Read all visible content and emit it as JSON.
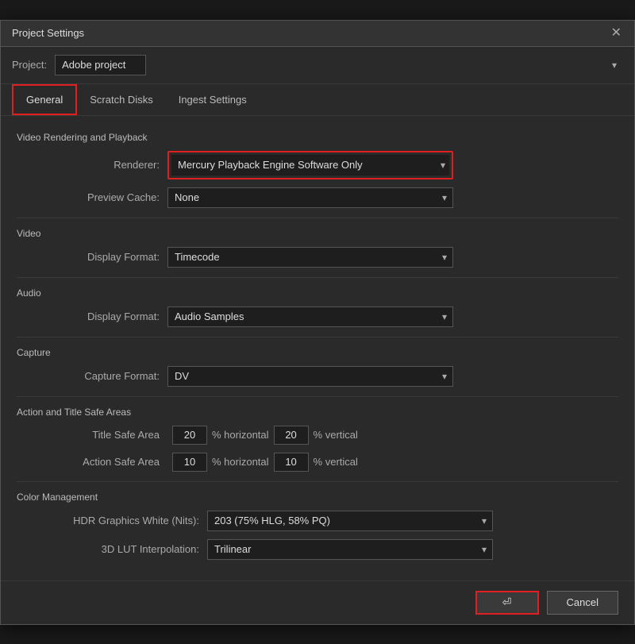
{
  "titleBar": {
    "title": "Project Settings",
    "closeLabel": "✕"
  },
  "projectRow": {
    "label": "Project:",
    "value": "Adobe project"
  },
  "tabs": [
    {
      "id": "general",
      "label": "General",
      "active": true
    },
    {
      "id": "scratch-disks",
      "label": "Scratch Disks",
      "active": false
    },
    {
      "id": "ingest-settings",
      "label": "Ingest Settings",
      "active": false
    }
  ],
  "sections": {
    "videoRenderingPlayback": {
      "title": "Video Rendering and Playback",
      "rendererLabel": "Renderer:",
      "rendererValue": "Mercury Playback Engine Software Only",
      "previewCacheLabel": "Preview Cache:",
      "previewCacheValue": "None"
    },
    "video": {
      "title": "Video",
      "displayFormatLabel": "Display Format:",
      "displayFormatValue": "Timecode"
    },
    "audio": {
      "title": "Audio",
      "displayFormatLabel": "Display Format:",
      "displayFormatValue": "Audio Samples"
    },
    "capture": {
      "title": "Capture",
      "captureFormatLabel": "Capture Format:",
      "captureFormatValue": "DV"
    },
    "actionTitleSafeAreas": {
      "title": "Action and Title Safe Areas",
      "titleSafeAreaLabel": "Title Safe Area",
      "titleSafeAreaHorizontal": "20",
      "titleSafeAreaVertical": "20",
      "actionSafeAreaLabel": "Action Safe Area",
      "actionSafeAreaHorizontal": "10",
      "actionSafeAreaVertical": "10",
      "percentHorizontal": "% horizontal",
      "percentVertical": "% vertical"
    },
    "colorManagement": {
      "title": "Color Management",
      "hdrLabel": "HDR Graphics White (Nits):",
      "hdrValue": "203 (75% HLG, 58% PQ)",
      "lutLabel": "3D LUT Interpolation:",
      "lutValue": "Trilinear"
    }
  },
  "footer": {
    "okIcon": "⏎",
    "cancelLabel": "Cancel"
  }
}
